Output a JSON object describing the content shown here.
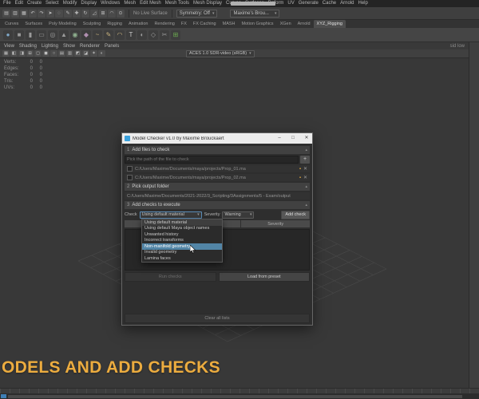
{
  "colors": {
    "accent": "#5285a6",
    "caption": "#ECAC3F"
  },
  "icons": {
    "caret_down": "▾",
    "collapse": "▴",
    "plus": "+",
    "lock": "▪",
    "remove": "✕"
  },
  "menubar": {
    "items": [
      "File",
      "Edit",
      "Create",
      "Select",
      "Modify",
      "Display",
      "Windows",
      "Mesh",
      "Edit Mesh",
      "Mesh Tools",
      "Mesh Display",
      "Curves",
      "Surfaces",
      "Deform",
      "UV",
      "Generate",
      "Cache",
      "Arnold",
      "Help"
    ]
  },
  "statusbar": {
    "icons": [
      {
        "name": "new-scene-icon",
        "glyph": "▤"
      },
      {
        "name": "open-scene-icon",
        "glyph": "▥"
      },
      {
        "name": "save-scene-icon",
        "glyph": "▦"
      },
      {
        "name": "undo-icon",
        "glyph": "↶"
      },
      {
        "name": "redo-icon",
        "glyph": "↷"
      },
      {
        "name": "select-tool-icon",
        "glyph": "➤"
      },
      {
        "name": "lasso-tool-icon",
        "glyph": "◌"
      },
      {
        "name": "paint-select-icon",
        "glyph": "✎"
      },
      {
        "name": "move-tool-icon",
        "glyph": "✚"
      },
      {
        "name": "rotate-tool-icon",
        "glyph": "↻"
      },
      {
        "name": "scale-tool-icon",
        "glyph": "◿"
      },
      {
        "name": "snap-grid-icon",
        "glyph": "⊞"
      },
      {
        "name": "snap-curve-icon",
        "glyph": "◠"
      },
      {
        "name": "snap-point-icon",
        "glyph": "⊙"
      }
    ],
    "no_live_surface": "No Live Surface",
    "symmetry": "Symmetry: Off",
    "workspace": "Maxime's Brou..."
  },
  "shelf": {
    "tabs": [
      {
        "label": "Curves"
      },
      {
        "label": "Surfaces"
      },
      {
        "label": "Poly Modeling"
      },
      {
        "label": "Sculpting"
      },
      {
        "label": "Rigging"
      },
      {
        "label": "Animation"
      },
      {
        "label": "Rendering"
      },
      {
        "label": "FX"
      },
      {
        "label": "FX Caching"
      },
      {
        "label": "MASH"
      },
      {
        "label": "Motion Graphics"
      },
      {
        "label": "XGen"
      },
      {
        "label": "Arnold"
      },
      {
        "label": "XYZ_Rigging",
        "cls": "sel"
      }
    ],
    "icons": [
      {
        "name": "poly-sphere-icon",
        "glyph": "●",
        "color": "#7fa8c8"
      },
      {
        "name": "poly-cube-icon",
        "glyph": "■",
        "color": "#9a9a9a"
      },
      {
        "name": "poly-cylinder-icon",
        "glyph": "▮",
        "color": "#9a9a9a"
      },
      {
        "name": "poly-plane-icon",
        "glyph": "▭",
        "color": "#9a9a9a"
      },
      {
        "name": "poly-torus-icon",
        "glyph": "◎",
        "color": "#9a9a9a"
      },
      {
        "name": "poly-cone-icon",
        "glyph": "▲",
        "color": "#9a9a9a"
      },
      {
        "name": "poly-disc-icon",
        "glyph": "◉",
        "color": "#8fb08f"
      },
      {
        "name": "platonic-solid-icon",
        "glyph": "◆",
        "color": "#b08fb0"
      },
      {
        "name": "curve-tool-icon",
        "glyph": "~",
        "color": "#c8b27f"
      },
      {
        "name": "pencil-curve-icon",
        "glyph": "✎",
        "color": "#c8b27f"
      },
      {
        "name": "arc-tool-icon",
        "glyph": "◠",
        "color": "#c8b27f"
      },
      {
        "name": "text-tool-icon",
        "glyph": "T",
        "color": "#cccccc"
      },
      {
        "name": "boolean-icon",
        "glyph": "◐",
        "color": "#9a9a9a"
      },
      {
        "name": "bevel-icon",
        "glyph": "◇",
        "color": "#9a9a9a"
      },
      {
        "name": "multi-cut-icon",
        "glyph": "✂",
        "color": "#9a9a9a"
      },
      {
        "name": "quad-draw-icon",
        "glyph": "⊞",
        "color": "#6aa84f"
      }
    ]
  },
  "panel": {
    "menus": [
      "View",
      "Shading",
      "Lighting",
      "Show",
      "Renderer",
      "Panels"
    ],
    "toolbar_icons": [
      {
        "name": "select-camera-icon",
        "glyph": "▦"
      },
      {
        "name": "lock-camera-icon",
        "glyph": "◧"
      },
      {
        "name": "camera-attributes-icon",
        "glyph": "◨"
      },
      {
        "name": "bookmark-icon",
        "glyph": "⊞"
      },
      {
        "name": "image-plane-icon",
        "glyph": "◻"
      },
      {
        "name": "view-grid-icon",
        "glyph": "◼"
      },
      {
        "name": "film-gate-icon",
        "glyph": "○"
      },
      {
        "name": "resolution-gate-icon",
        "glyph": "▤"
      },
      {
        "name": "gate-mask-icon",
        "glyph": "▥"
      },
      {
        "name": "safe-action-icon",
        "glyph": "◩"
      },
      {
        "name": "safe-title-icon",
        "glyph": "◪"
      },
      {
        "name": "lighting-icon",
        "glyph": "✶"
      },
      {
        "name": "shadows-icon",
        "glyph": "◐"
      }
    ],
    "colorspace": "ACES 1.0 SDR-video (sRGB)",
    "right_hud": "sid low"
  },
  "hud": {
    "rows": [
      {
        "label": "Verts:",
        "a": "0",
        "b": "0"
      },
      {
        "label": "Edges:",
        "a": "0",
        "b": "0"
      },
      {
        "label": "Faces:",
        "a": "0",
        "b": "0"
      },
      {
        "label": "Tris:",
        "a": "0",
        "b": "0"
      },
      {
        "label": "UVs:",
        "a": "0",
        "b": "0"
      }
    ]
  },
  "dialog": {
    "title": "Model Checker v1.0 by Maxime Brouckaert",
    "controls": {
      "minimize": "–",
      "maximize": "□",
      "close": "✕"
    },
    "files": {
      "num": "1",
      "label": "Add files to check",
      "placeholder": "Pick the path of the file to check",
      "rows": [
        {
          "path": "C:/Users/Maxime/Documents/maya/projects/Prop_01.ma"
        },
        {
          "path": "C:/Users/Maxime/Documents/maya/projects/Prop_02.ma"
        }
      ]
    },
    "output": {
      "num": "2",
      "label": "Pick output folder",
      "path": "C:/Users/Maxime/Documents/2021-2022/3_Scripting/3Assignments/5 - Exam/output"
    },
    "checks": {
      "num": "3",
      "label": "Add checks to execute",
      "check_label": "Check",
      "check_value": "Using default material",
      "severity_label": "Severity",
      "severity_value": "Warning",
      "add_button": "Add check",
      "options": [
        {
          "label": "Using default material",
          "cls": "cur"
        },
        {
          "label": "Using default Maya object names"
        },
        {
          "label": "Unwanted history"
        },
        {
          "label": "Incorrect transforms"
        },
        {
          "label": "Non-manifold geometry",
          "cls": "hov"
        },
        {
          "label": "Invalid geometry"
        },
        {
          "label": "Lamina faces"
        }
      ]
    },
    "table": {
      "col_check": "Check",
      "col_severity": "Severity"
    },
    "buttons": {
      "run": "Run checks",
      "load": "Load from preset",
      "clear": "Clear all lists"
    }
  },
  "overlay": {
    "caption": "ODELS AND ADD CHECKS"
  }
}
